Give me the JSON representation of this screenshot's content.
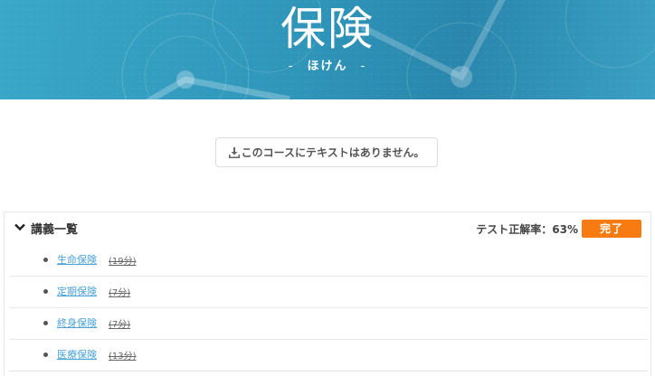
{
  "banner": {
    "title": "保険",
    "subtitle_dash_left": "-",
    "subtitle": "ほけん",
    "subtitle_dash_right": "-"
  },
  "text_notice": {
    "icon": "download-icon",
    "label": "このコースにテキストはありません。"
  },
  "lecture_panel": {
    "toggle_icon": "chevron-down-icon",
    "title": "講義一覧",
    "score_label": "テスト正解率：63%",
    "score_value_percent": 63,
    "status_badge": "完了",
    "badge_color": "#f77b10",
    "items": [
      {
        "title": "生命保険",
        "duration": "(19分)"
      },
      {
        "title": "定期保険",
        "duration": "(7分)"
      },
      {
        "title": "終身保険",
        "duration": "(7分)"
      },
      {
        "title": "医療保険",
        "duration": "(13分)"
      }
    ]
  },
  "colors": {
    "banner": "#2f96ba",
    "link": "#4aa3d8",
    "accent": "#f77b10"
  }
}
